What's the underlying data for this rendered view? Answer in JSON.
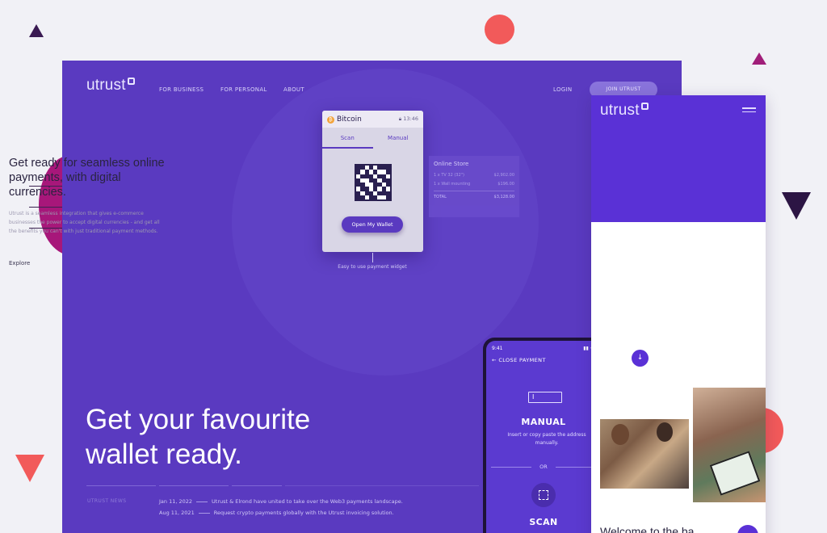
{
  "desktop": {
    "logo": "utrust",
    "nav": [
      "FOR BUSINESS",
      "FOR PERSONAL",
      "ABOUT"
    ],
    "login": "LOGIN",
    "join_button": "JOIN UTRUST",
    "headline_line1": "Get your favourite",
    "headline_line2": "wallet ready.",
    "caption": "Easy to use payment widget",
    "news_label": "UTRUST NEWS",
    "news": [
      {
        "date": "Jan 11, 2022",
        "text": "Utrust & Elrond have united to take over the Web3 payments landscape."
      },
      {
        "date": "Aug 11, 2021",
        "text": "Request crypto payments globally with the Utrust invoicing solution."
      }
    ]
  },
  "widget": {
    "currency": "Bitcoin",
    "timer": "13:46",
    "tab_scan": "Scan",
    "tab_manual": "Manual",
    "wallet_button": "Open My Wallet"
  },
  "order": {
    "title": "Online Store",
    "rows": [
      {
        "label": "1 x TV 32 (32\")",
        "value": "$2,902.00"
      },
      {
        "label": "1 x Wall mounting",
        "value": "$196.00"
      }
    ],
    "total_label": "TOTAL",
    "total_value": "$3,128.00"
  },
  "phone": {
    "time": "9:41",
    "close": "CLOSE PAYMENT",
    "input_cursor": "I",
    "manual_title": "MANUAL",
    "manual_desc": "Insert or copy paste the address manually.",
    "or": "OR",
    "scan_title": "SCAN"
  },
  "mobile": {
    "logo": "utrust",
    "headline": "Get ready for seamless online payments, with digital currencies.",
    "description": "Utrust is a seamless integration that gives e-commerce businesses the power to accept digital currencies - and get all the benefits you can't with just traditional payment methods.",
    "explore": "Explore",
    "explore_icon": "↓",
    "welcome": "Welcome to the ba"
  },
  "colors": {
    "brand_purple": "#5a3ac0",
    "mobile_purple": "#5a31d6",
    "accent_red": "#f25a5a",
    "accent_magenta": "#a7177a"
  }
}
